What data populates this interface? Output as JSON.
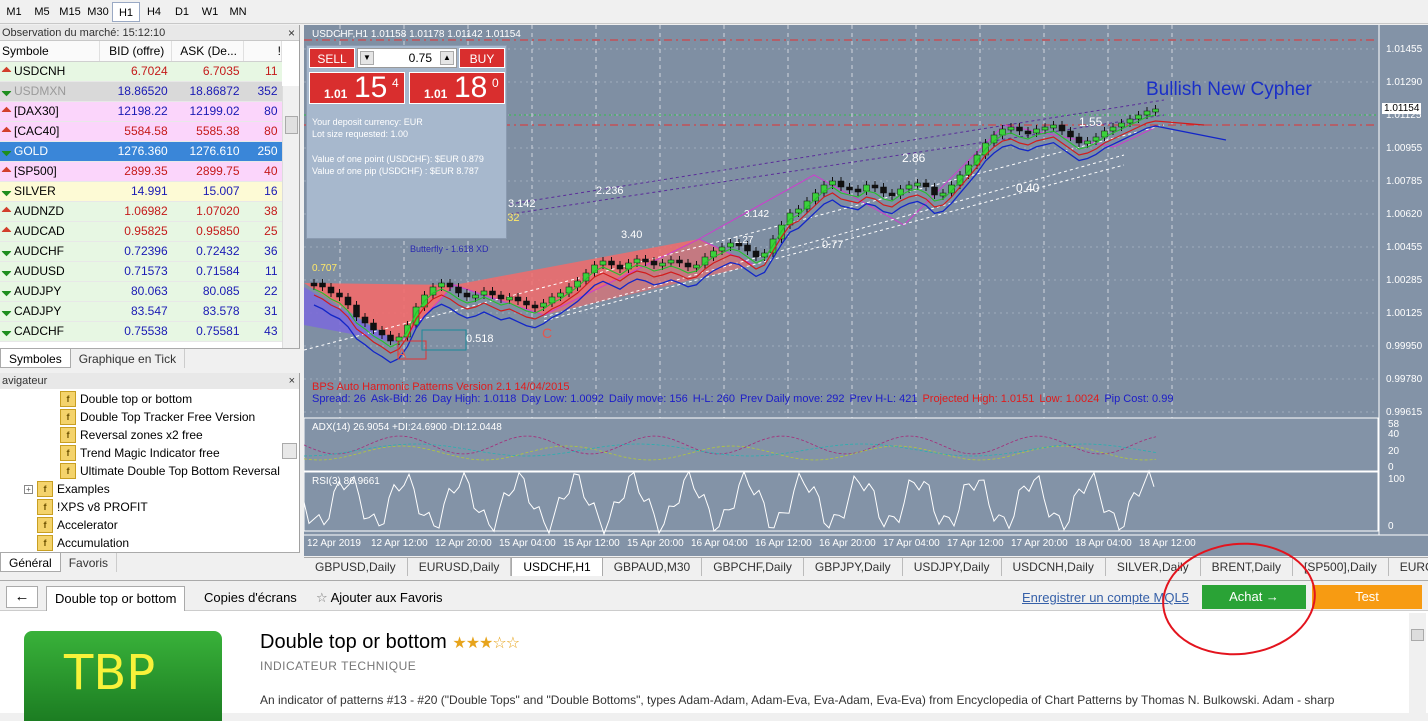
{
  "timeframes": [
    {
      "label": "M1",
      "active": false
    },
    {
      "label": "M5",
      "active": false
    },
    {
      "label": "M15",
      "active": false
    },
    {
      "label": "M30",
      "active": false
    },
    {
      "label": "H1",
      "active": true
    },
    {
      "label": "H4",
      "active": false
    },
    {
      "label": "D1",
      "active": false
    },
    {
      "label": "W1",
      "active": false
    },
    {
      "label": "MN",
      "active": false
    }
  ],
  "market_watch": {
    "title": "Observation du marché: 15:12:10",
    "close": "×",
    "columns": [
      "Symbole",
      "BID (offre)",
      "ASK (De...",
      "!"
    ],
    "rows": [
      {
        "sym": "USDCNH",
        "bid": "6.7024",
        "ask": "6.7035",
        "spread": "11",
        "dir": "dn",
        "color": "#c41a1a",
        "bg": "#e7f7e3"
      },
      {
        "sym": "USDMXN",
        "bid": "18.86520",
        "ask": "18.86872",
        "spread": "352",
        "dir": "up",
        "color": "#1a1ab4",
        "bg": "#d9d9d9",
        "symcolor": "#9a9a9a"
      },
      {
        "sym": "[DAX30]",
        "bid": "12198.22",
        "ask": "12199.02",
        "spread": "80",
        "dir": "dn",
        "color": "#1a1ab4",
        "bg": "#fbd5fb"
      },
      {
        "sym": "[CAC40]",
        "bid": "5584.58",
        "ask": "5585.38",
        "spread": "80",
        "dir": "dn",
        "color": "#c41a1a",
        "bg": "#fbd5fb"
      },
      {
        "sym": "GOLD",
        "bid": "1276.360",
        "ask": "1276.610",
        "spread": "250",
        "dir": "up",
        "color": "#fff",
        "bg": "#3a86d8",
        "symcolor": "#fff"
      },
      {
        "sym": "[SP500]",
        "bid": "2899.35",
        "ask": "2899.75",
        "spread": "40",
        "dir": "dn",
        "color": "#c41a1a",
        "bg": "#fbd5fb"
      },
      {
        "sym": "SILVER",
        "bid": "14.991",
        "ask": "15.007",
        "spread": "16",
        "dir": "up",
        "color": "#1a1ab4",
        "bg": "#fdfad5"
      },
      {
        "sym": "AUDNZD",
        "bid": "1.06982",
        "ask": "1.07020",
        "spread": "38",
        "dir": "dn",
        "color": "#c41a1a",
        "bg": "#e7f7e3"
      },
      {
        "sym": "AUDCAD",
        "bid": "0.95825",
        "ask": "0.95850",
        "spread": "25",
        "dir": "dn",
        "color": "#c41a1a",
        "bg": "#e7f7e3"
      },
      {
        "sym": "AUDCHF",
        "bid": "0.72396",
        "ask": "0.72432",
        "spread": "36",
        "dir": "up",
        "color": "#1a1ab4",
        "bg": "#e7f7e3"
      },
      {
        "sym": "AUDUSD",
        "bid": "0.71573",
        "ask": "0.71584",
        "spread": "11",
        "dir": "up",
        "color": "#1a1ab4",
        "bg": "#e7f7e3"
      },
      {
        "sym": "AUDJPY",
        "bid": "80.063",
        "ask": "80.085",
        "spread": "22",
        "dir": "up",
        "color": "#1a1ab4",
        "bg": "#e7f7e3"
      },
      {
        "sym": "CADJPY",
        "bid": "83.547",
        "ask": "83.578",
        "spread": "31",
        "dir": "up",
        "color": "#1a1ab4",
        "bg": "#e7f7e3"
      },
      {
        "sym": "CADCHF",
        "bid": "0.75538",
        "ask": "0.75581",
        "spread": "43",
        "dir": "up",
        "color": "#1a1ab4",
        "bg": "#e7f7e3"
      }
    ],
    "tabs": [
      "Symboles",
      "Graphique en Tick"
    ]
  },
  "navigator": {
    "title": "avigateur",
    "items": [
      "Double top or bottom",
      "Double Top Tracker Free Version",
      "Reversal zones x2 free",
      "Trend Magic Indicator free",
      "Ultimate Double Top Bottom Reversal",
      "Examples",
      "!XPS v8 PROFIT",
      "Accelerator",
      "Accumulation"
    ],
    "tabs": [
      "Général",
      "Favoris"
    ]
  },
  "trade_panel": {
    "sell": "SELL",
    "buy": "BUY",
    "lot": "0.75",
    "sell_small": "1.01",
    "sell_big": "15",
    "sell_pip": "4",
    "buy_small": "1.01",
    "buy_big": "18",
    "buy_pip": "0",
    "info": [
      "Your deposit currency: EUR",
      "Lot size requested: 1.00",
      "Value of one point (USDCHF):   $EUR 0.879",
      "Value of one pip     (USDCHF) : $EUR 8.787"
    ]
  },
  "chart": {
    "header": "USDCHF,H1  1.01158 1.01178 1.01142 1.01154",
    "price_axis": [
      "1.01455",
      "1.01290",
      "1.01125",
      "1.00955",
      "1.00785",
      "1.00620",
      "1.00455",
      "1.00285",
      "1.00125",
      "0.99950",
      "0.99780",
      "0.99615"
    ],
    "current_price": "1.01154",
    "pattern_title": "Bullish New Cypher",
    "pattern_labels": [
      "A",
      "C",
      "2.236",
      "3.142",
      "1.732",
      "3.40",
      "2.86",
      "1.55",
      "0.40",
      "0.77",
      "3.142",
      "1.27",
      "0.707",
      "0.518",
      "Butterfly - 1.618 XD"
    ],
    "indicator_name": "BPS Auto Harmonic Patterns Version 2.1 14/04/2015",
    "stats": [
      {
        "label": "Spread:",
        "value": "26",
        "color": "#1c1cc8"
      },
      {
        "label": "Ask-Bid:",
        "value": "26",
        "color": "#1c1cc8"
      },
      {
        "label": "Day High:",
        "value": "1.0118",
        "color": "#1c1cc8"
      },
      {
        "label": "Day Low:",
        "value": "1.0092",
        "color": "#1c1cc8"
      },
      {
        "label": "Daily move:",
        "value": "156",
        "color": "#1c1cc8"
      },
      {
        "label": "H-L:",
        "value": "260",
        "color": "#1c1cc8"
      },
      {
        "label": "Prev Daily move:",
        "value": "292",
        "color": "#1c1cc8"
      },
      {
        "label": "Prev H-L:",
        "value": "421",
        "color": "#1c1cc8"
      },
      {
        "label": "Projected High:",
        "value": "1.0151",
        "color": "#e01c1c"
      },
      {
        "label": "Low:",
        "value": "1.0024",
        "color": "#e01c1c"
      },
      {
        "label": "Pip Cost:",
        "value": "0.99",
        "color": "#1c1cc8"
      }
    ],
    "adx_label": "ADX(14) 26.9054 +DI:24.6900 -DI:12.0448",
    "adx_axis": [
      "58",
      "40",
      "20",
      "0"
    ],
    "rsi_label": "RSI(3) 86.9661",
    "rsi_axis": [
      "100",
      "0"
    ],
    "time_axis": [
      "12 Apr 2019",
      "12 Apr 12:00",
      "12 Apr 20:00",
      "15 Apr 04:00",
      "15 Apr 12:00",
      "15 Apr 20:00",
      "16 Apr 04:00",
      "16 Apr 12:00",
      "16 Apr 20:00",
      "17 Apr 04:00",
      "17 Apr 12:00",
      "17 Apr 20:00",
      "18 Apr 04:00",
      "18 Apr 12:00"
    ]
  },
  "symbol_tabs": [
    "GBPUSD,Daily",
    "EURUSD,Daily",
    "USDCHF,H1",
    "GBPAUD,M30",
    "GBPCHF,Daily",
    "GBPJPY,Daily",
    "USDJPY,Daily",
    "USDCNH,Daily",
    "SILVER,Daily",
    "BRENT,Daily",
    "[SP500],Daily",
    "EURCHF,M"
  ],
  "active_symbol_tab": "USDCHF,H1",
  "market": {
    "back": "←",
    "tabs": [
      "Double top or bottom",
      "Copies d'écrans",
      "Ajouter aux Favoris"
    ],
    "register": "Enregistrer un compte MQL5",
    "buy": "Achat →",
    "test": "Test",
    "logo": "TBP",
    "title": "Double top or bottom",
    "stars": "★★★☆☆",
    "rating": 3,
    "category": "INDICATEUR TECHNIQUE",
    "description": "An indicator of patterns #13 - #20 (\"Double Tops\" and \"Double Bottoms\", types Adam-Adam, Adam-Eva, Eva-Adam, Eva-Eva) from Encyclopedia of Chart Patterns by Thomas N. Bulkowski. Adam - sharp"
  }
}
